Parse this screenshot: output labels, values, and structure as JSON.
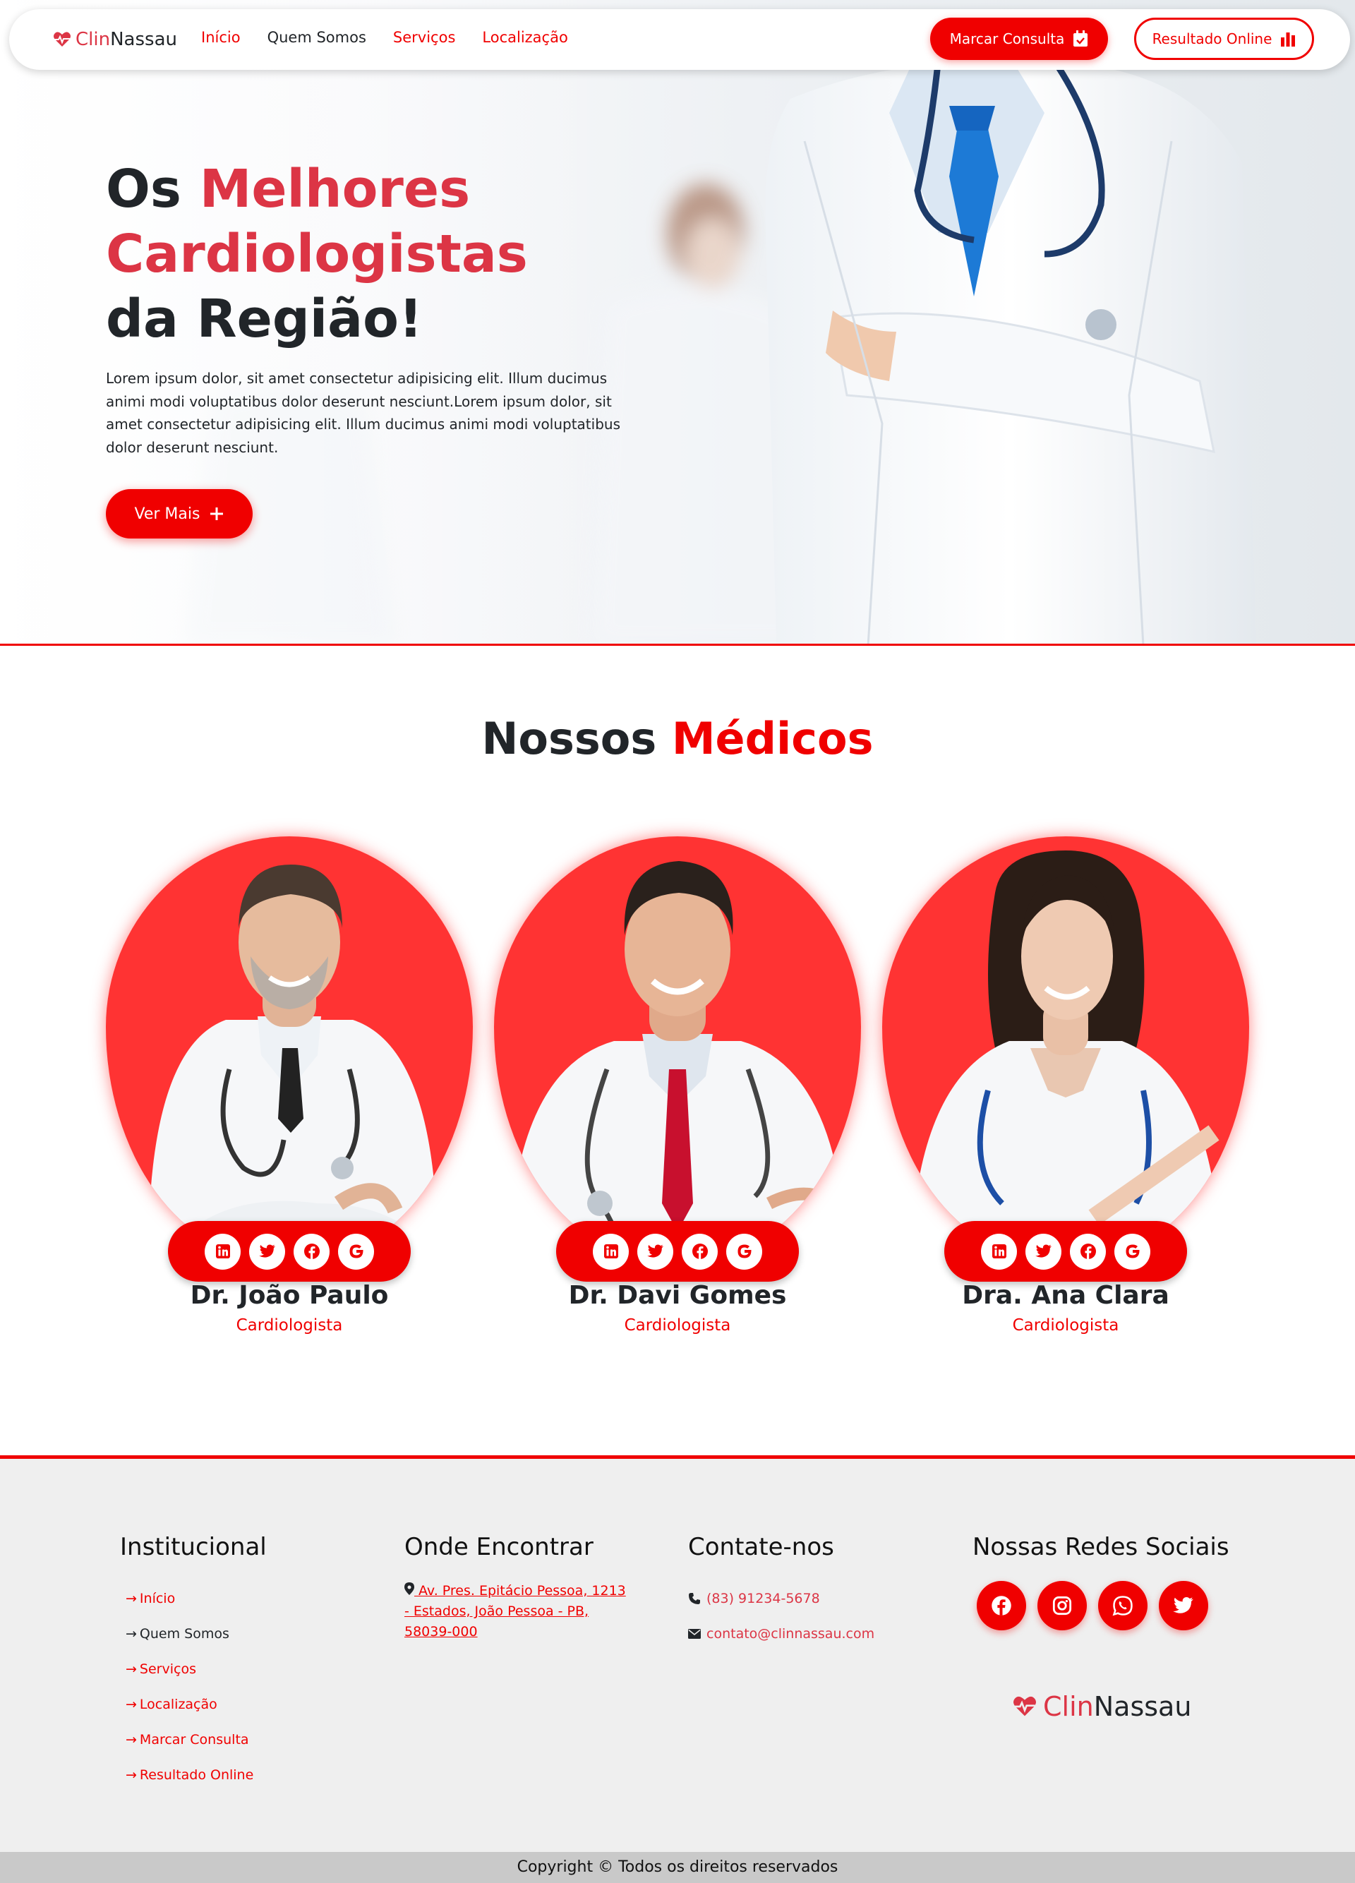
{
  "brand": {
    "part1": "Clin",
    "part2": "Nassau",
    "icon": "heartbeat-icon"
  },
  "nav": {
    "items": [
      {
        "label": "Início",
        "active": true
      },
      {
        "label": "Quem Somos",
        "active": false
      },
      {
        "label": "Serviços",
        "active": false
      },
      {
        "label": "Localização",
        "active": false
      }
    ],
    "consulta_label": "Marcar Consulta",
    "consulta_icon": "calendar-check-icon",
    "resultado_label": "Resultado Online",
    "resultado_icon": "bar-chart-icon"
  },
  "hero": {
    "title_part1": "Os ",
    "title_part2": "Melhores",
    "title_part3": "Cardiologistas",
    "title_part4": "da Região!",
    "text": "Lorem ipsum dolor, sit amet consectetur adipisicing elit. Illum ducimus animi modi voluptatibus dolor deserunt nesciunt.Lorem ipsum dolor, sit amet consectetur adipisicing elit. Illum ducimus animi modi voluptatibus dolor deserunt nesciunt.",
    "button_label": "Ver Mais",
    "button_icon": "plus-icon"
  },
  "doctors_section": {
    "title_part1": "Nossos ",
    "title_part2": "Médicos",
    "doctors": [
      {
        "name": "Dr. João Paulo",
        "role": "Cardiologista"
      },
      {
        "name": "Dr. Davi Gomes",
        "role": "Cardiologista"
      },
      {
        "name": "Dra. Ana Clara",
        "role": "Cardiologista"
      }
    ],
    "social_icons": [
      "linkedin-icon",
      "twitter-icon",
      "facebook-icon",
      "google-icon"
    ]
  },
  "footer": {
    "institucional": {
      "title": "Institucional",
      "links": [
        "Início",
        "Quem Somos",
        "Serviços",
        "Localização",
        "Marcar Consulta",
        "Resultado Online"
      ]
    },
    "onde": {
      "title": "Onde Encontrar",
      "address": "Av. Pres. Epitácio Pessoa, 1213 - Estados, João Pessoa - PB, 58039-000"
    },
    "contato": {
      "title": "Contate-nos",
      "phone": "(83) 91234-5678",
      "email": "contato@clinnassau.com"
    },
    "redes": {
      "title": "Nossas Redes Sociais",
      "icons": [
        "facebook-icon",
        "instagram-icon",
        "whatsapp-icon",
        "twitter-icon"
      ]
    },
    "brand_part1": "Clin",
    "brand_part2": "Nassau"
  },
  "copyright": "Copyright © Todos os direitos reservados",
  "colors": {
    "accent": "#f00000",
    "brand_red": "#dc3545",
    "dark": "#212529",
    "footer_bg": "#efefef",
    "copyright_bg": "#c9c9c9"
  }
}
